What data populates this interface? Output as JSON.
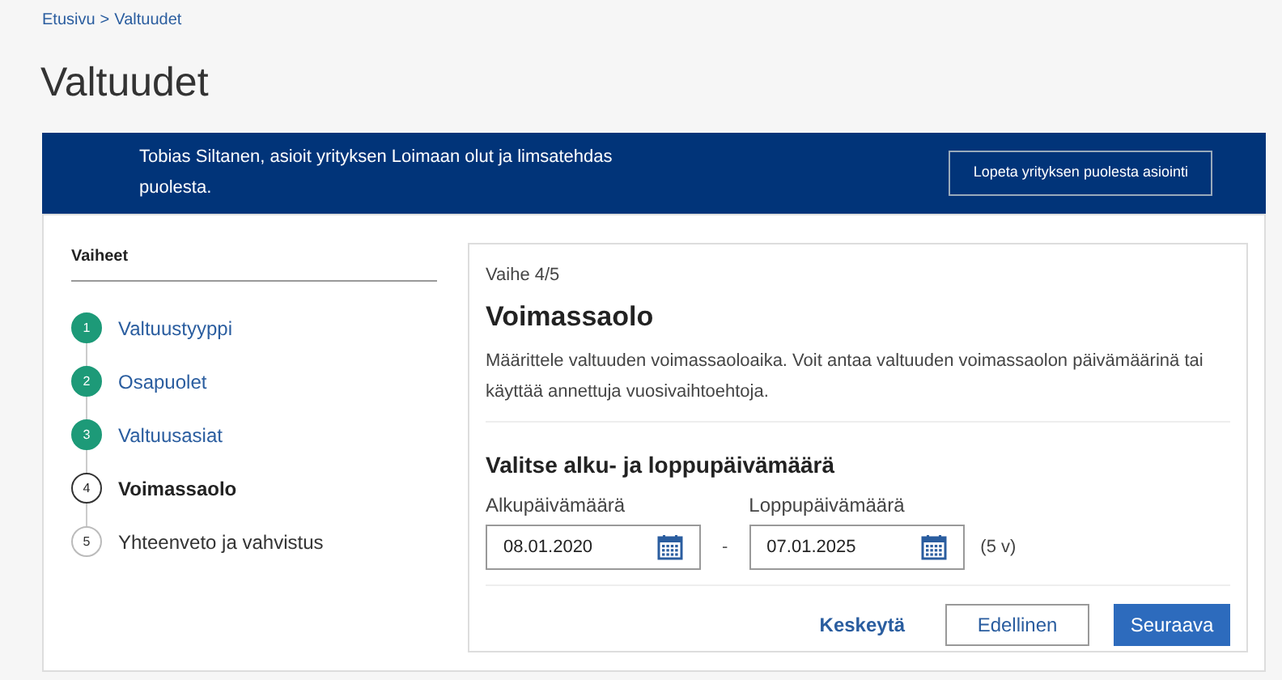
{
  "breadcrumb": {
    "items": [
      "Etusivu",
      "Valtuudet"
    ],
    "separator": ">"
  },
  "title": "Valtuudet",
  "banner": {
    "text": "Tobias Siltanen, asioit yrityksen Loimaan olut ja limsatehdas puolesta.",
    "button": "Lopeta yrityksen puolesta asiointi"
  },
  "steps": {
    "heading": "Vaiheet",
    "items": [
      {
        "number": "1",
        "label": "Valtuustyyppi",
        "kind": "done"
      },
      {
        "number": "2",
        "label": "Osapuolet",
        "kind": "done"
      },
      {
        "number": "3",
        "label": "Valtuusasiat",
        "kind": "done"
      },
      {
        "number": "4",
        "label": "Voimassaolo",
        "kind": "current"
      },
      {
        "number": "5",
        "label": "Yhteenveto ja vahvistus",
        "kind": "upcoming"
      }
    ]
  },
  "form": {
    "step_label": "Vaihe 4/5",
    "heading": "Voimassaolo",
    "description": "Määrittele valtuuden voimassaoloaika. Voit antaa valtuuden voimassaolon päivämäärinä tai käyttää annettuja vuosivaihtoehtoja.",
    "subheading": "Valitse alku- ja loppupäivämäärä",
    "start": {
      "label": "Alkupäivämäärä",
      "value": "08.01.2020"
    },
    "dash": "-",
    "end": {
      "label": "Loppupäivämäärä",
      "value": "07.01.2025"
    },
    "duration": "(5 v)",
    "buttons": {
      "cancel": "Keskeytä",
      "previous": "Edellinen",
      "next": "Seuraava"
    }
  }
}
